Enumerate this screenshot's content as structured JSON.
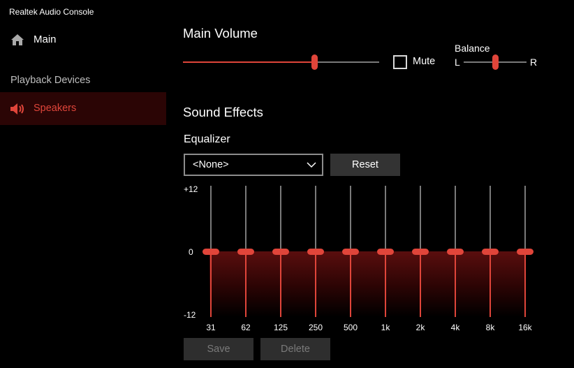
{
  "window": {
    "title": "Realtek Audio Console"
  },
  "sidebar": {
    "main_label": "Main",
    "section_label": "Playback Devices",
    "items": [
      {
        "label": "Speakers",
        "selected": true,
        "icon": "speaker-icon"
      }
    ]
  },
  "main_volume": {
    "heading": "Main Volume",
    "value_fraction": 0.67,
    "mute_label": "Mute",
    "muted": false,
    "balance": {
      "label": "Balance",
      "left": "L",
      "right": "R",
      "value_fraction": 0.5
    }
  },
  "sound_effects": {
    "heading": "Sound Effects",
    "equalizer": {
      "label": "Equalizer",
      "preset": "<None>",
      "reset_label": "Reset",
      "db_max": "+12",
      "db_zero": "0",
      "db_min": "-12",
      "range": [
        -12,
        12
      ],
      "bands": [
        {
          "freq": "31",
          "gain": 0
        },
        {
          "freq": "62",
          "gain": 0
        },
        {
          "freq": "125",
          "gain": 0
        },
        {
          "freq": "250",
          "gain": 0
        },
        {
          "freq": "500",
          "gain": 0
        },
        {
          "freq": "1k",
          "gain": 0
        },
        {
          "freq": "2k",
          "gain": 0
        },
        {
          "freq": "4k",
          "gain": 0
        },
        {
          "freq": "8k",
          "gain": 0
        },
        {
          "freq": "16k",
          "gain": 0
        }
      ],
      "save_label": "Save",
      "delete_label": "Delete"
    }
  },
  "colors": {
    "accent": "#e0453a",
    "selected_bg": "#2b0505"
  }
}
